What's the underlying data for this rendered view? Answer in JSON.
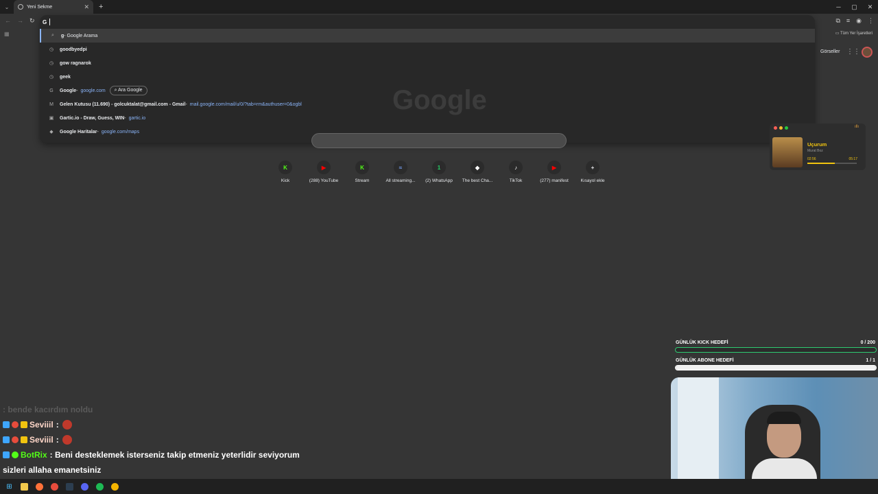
{
  "browser": {
    "tab_title": "Yeni Sekme",
    "omnibox_value": "G",
    "bookmarks_label": "Tüm Yer İşaretleri"
  },
  "suggestions": [
    {
      "icon": "search-icon",
      "bold": "g",
      "text": " - Google Arama",
      "url": "",
      "pill": ""
    },
    {
      "icon": "history-icon",
      "bold": "goodbyedpi",
      "text": "",
      "url": "",
      "pill": ""
    },
    {
      "icon": "history-icon",
      "bold": "gow ragnarok",
      "text": "",
      "url": "",
      "pill": ""
    },
    {
      "icon": "history-icon",
      "bold": "geek",
      "text": "",
      "url": "",
      "pill": ""
    },
    {
      "icon": "google-icon",
      "bold": "Google",
      "text": " - ",
      "url": "google.com",
      "pill": "Ara Google"
    },
    {
      "icon": "gmail-icon",
      "bold": "Gelen Kutusu (11.690) - golcuktalat@gmail.com - Gmail",
      "text": " - ",
      "url": "mail.google.com/mail/u/0/?tab=rm&authuser=0&ogbl",
      "pill": ""
    },
    {
      "icon": "gartic-icon",
      "bold": "Gartic.io - Draw, Guess, WIN",
      "text": " - ",
      "url": "gartic.io",
      "pill": ""
    },
    {
      "icon": "maps-icon",
      "bold": "Google Haritalar",
      "text": " - ",
      "url": "google.com/maps",
      "pill": ""
    }
  ],
  "ntp": {
    "images_label": "Görseller",
    "logo_text": "Google",
    "shortcuts": [
      {
        "label": "Kick",
        "glyph": "K",
        "color": "#53fc18"
      },
      {
        "label": "(288) YouTube",
        "glyph": "▶",
        "color": "#ff0000"
      },
      {
        "label": "Stream",
        "glyph": "K",
        "color": "#53fc18"
      },
      {
        "label": "All streaming...",
        "glyph": "≈",
        "color": "#7aa7ff"
      },
      {
        "label": "(2) WhatsApp",
        "glyph": "1",
        "color": "#25d366"
      },
      {
        "label": "The best Cha...",
        "glyph": "◆",
        "color": "#ffffff"
      },
      {
        "label": "TikTok",
        "glyph": "♪",
        "color": "#ffffff"
      },
      {
        "label": "(277) manifest",
        "glyph": "▶",
        "color": "#ff0000"
      },
      {
        "label": "Kısayol ekle",
        "glyph": "+",
        "color": "#e8eaed"
      }
    ]
  },
  "player": {
    "title": "Uçurum",
    "artist": "Murat Boz",
    "elapsed": "02:56",
    "duration": "05:17",
    "progress": 0.56
  },
  "goals": [
    {
      "name": "GÜNLÜK KICK HEDEFİ",
      "value": "0 / 200",
      "fraction": 0
    },
    {
      "name": "GÜNLÜK ABONE HEDEFİ",
      "value": "1 / 1",
      "fraction": 1
    }
  ],
  "chat": [
    {
      "user": "",
      "message": ": bende kacırdım noldu",
      "faded": true,
      "name_color": "#5a5a5a"
    },
    {
      "user": "Seviiil",
      "message": ":",
      "faded": false,
      "name_color": "#ffd7c9"
    },
    {
      "user": "Seviiil",
      "message": ":",
      "faded": false,
      "name_color": "#ffd7c9"
    },
    {
      "user": "BotRix",
      "message": ": Beni desteklemek isterseniz takip etmeniz yeterlidir seviyorum",
      "faded": false,
      "name_color": "#53fc18"
    },
    {
      "user": "",
      "message": "sizleri allaha emanetsiniz",
      "faded": false,
      "name_color": "#ffffff"
    }
  ]
}
